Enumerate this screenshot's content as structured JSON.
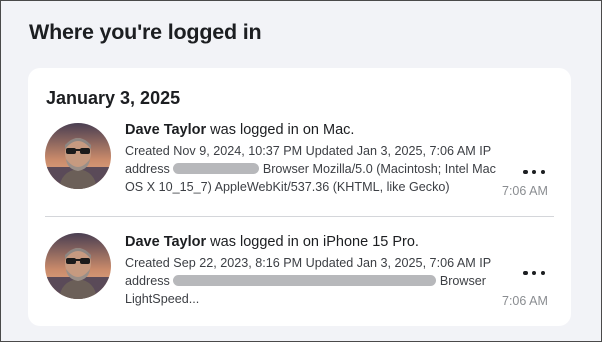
{
  "page": {
    "title": "Where you're logged in"
  },
  "group": {
    "date": "January 3, 2025"
  },
  "sessions": [
    {
      "user": "Dave Taylor",
      "action": " was logged in on Mac.",
      "line1": "Created Nov 9, 2024, 10:37 PM Updated Jan 3, 2025, 7:06 AM IP",
      "line2_start": "address",
      "line2_end": "Browser Mozilla/5.0 (Macintosh; Intel Mac",
      "line3": "OS X 10_15_7) AppleWebKit/537.36 (KHTML, like Gecko)",
      "time": "7:06 AM",
      "more_icon": "more-horizontal-icon"
    },
    {
      "user": "Dave Taylor",
      "action": " was logged in on iPhone 15 Pro.",
      "line1": "Created Sep 22, 2023, 8:16 PM Updated Jan 3, 2025, 7:06 AM IP",
      "line2_start": "address",
      "line2_end": "Browser",
      "line3": "LightSpeed...",
      "time": "7:06 AM",
      "more_icon": "more-horizontal-icon"
    }
  ]
}
